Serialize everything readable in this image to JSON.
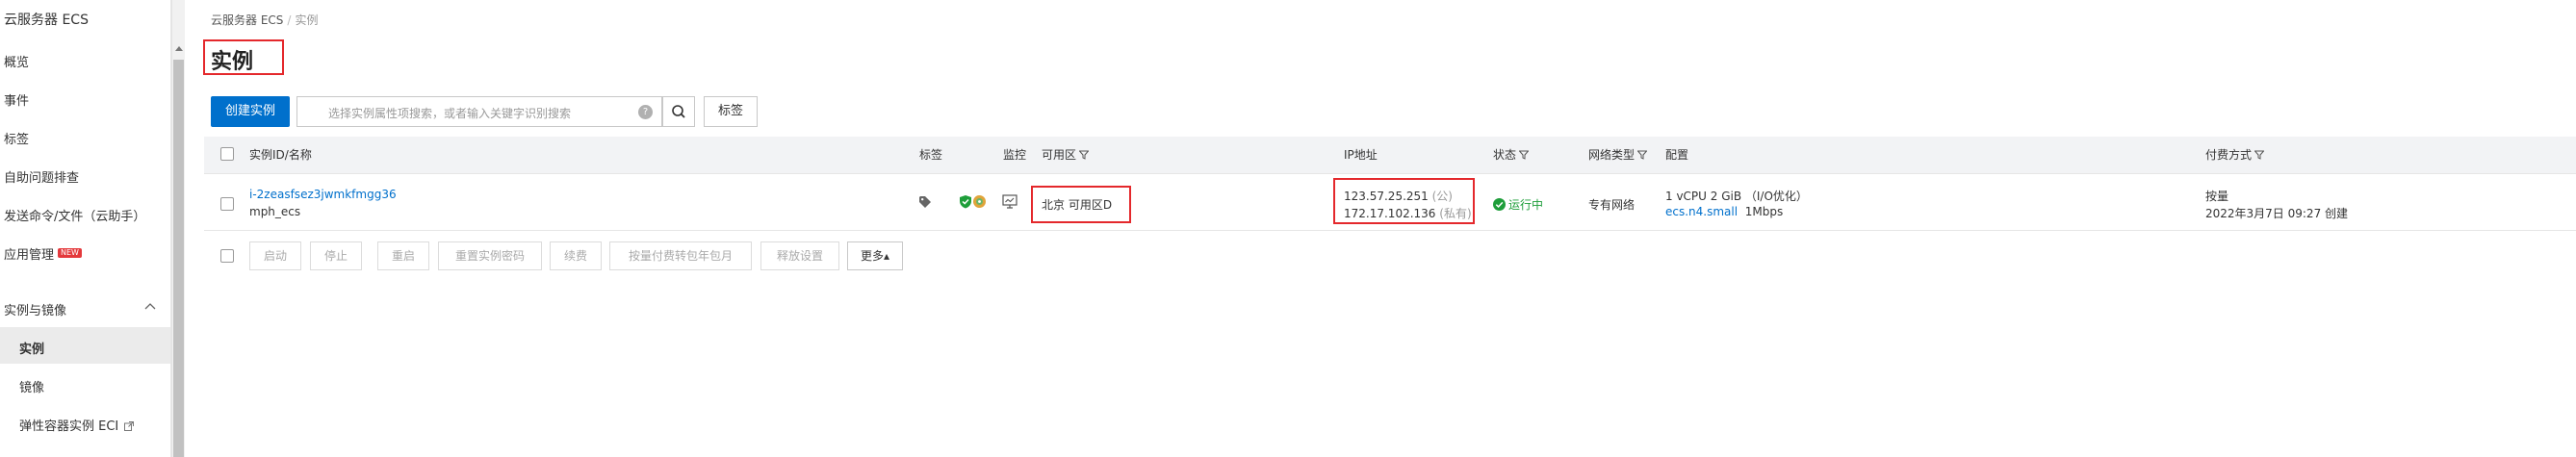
{
  "sidebar": {
    "title": "云服务器 ECS",
    "items": [
      {
        "label": "概览"
      },
      {
        "label": "事件"
      },
      {
        "label": "标签"
      },
      {
        "label": "自助问题排查"
      },
      {
        "label": "发送命令/文件（云助手）"
      },
      {
        "label": "应用管理",
        "badge": "NEW"
      }
    ],
    "section": {
      "label": "实例与镜像"
    },
    "sub_items": [
      {
        "label": "实例"
      },
      {
        "label": "镜像"
      },
      {
        "label": "弹性容器实例 ECI"
      }
    ]
  },
  "breadcrumb": {
    "root": "云服务器 ECS",
    "sep": "/",
    "current": "实例"
  },
  "page": {
    "title": "实例"
  },
  "toolbar": {
    "create_label": "创建实例",
    "search_placeholder": "选择实例属性项搜索，或者输入关键字识别搜索",
    "help_glyph": "?",
    "tag_label": "标签"
  },
  "table": {
    "headers": {
      "id_name": "实例ID/名称",
      "tag": "标签",
      "monitor": "监控",
      "zone": "可用区",
      "ip": "IP地址",
      "status": "状态",
      "network": "网络类型",
      "config": "配置",
      "billing": "付费方式"
    },
    "rows": [
      {
        "id": "i-2zeasfsez3jwmkfmgg36",
        "name": "mph_ecs",
        "zone": "北京 可用区D",
        "public_ip": "123.57.25.251",
        "public_suffix": "(公)",
        "private_ip": "172.17.102.136",
        "private_suffix": "(私有)",
        "status": "运行中",
        "network": "专有网络",
        "config_line1": "1 vCPU 2 GiB （I/O优化）",
        "instance_type": "ecs.n4.small",
        "bandwidth": "1Mbps",
        "billing": "按量",
        "created": "2022年3月7日 09:27 创建"
      }
    ],
    "actions": [
      "启动",
      "停止",
      "重启",
      "重置实例密码",
      "续费",
      "按量付费转包年包月",
      "释放设置"
    ],
    "more_label": "更多▴"
  },
  "colors": {
    "primary": "#0070cc",
    "highlight": "#e4282c",
    "running": "#1e9e3a"
  }
}
